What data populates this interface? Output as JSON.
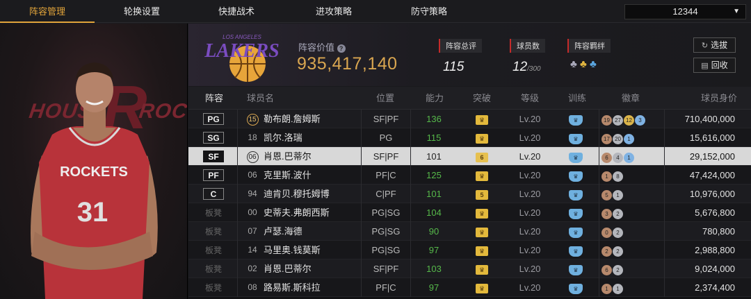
{
  "tabs": [
    {
      "label": "阵容管理",
      "active": true
    },
    {
      "label": "轮换设置",
      "active": false
    },
    {
      "label": "快捷战术",
      "active": false
    },
    {
      "label": "进攻策略",
      "active": false
    },
    {
      "label": "防守策略",
      "active": false
    }
  ],
  "dropdown": {
    "value": "12344"
  },
  "player_panel": {
    "bg_left": "HOUST",
    "bg_right": "ROCK",
    "jersey_team": "ROCKETS",
    "jersey_number": "31"
  },
  "team": {
    "logo_text_top": "LOS ANGELES",
    "logo_text": "LAKERS",
    "value_label": "阵容价值",
    "value": "935,417,140",
    "rating_label": "阵容总评",
    "rating": "115",
    "players_label": "球员数",
    "players": "12",
    "players_max": "/300",
    "bond_label": "阵容羁绊",
    "select_button": "选拔",
    "recycle_button": "回收"
  },
  "table": {
    "headers": [
      "阵容",
      "球员名",
      "位置",
      "能力",
      "突破",
      "等级",
      "训练",
      "徽章",
      "球员身价"
    ],
    "rows": [
      {
        "slot": "PG",
        "starter": true,
        "num": "15",
        "name": "勒布朗.詹姆斯",
        "pos": "SF|PF",
        "ability": "136",
        "breakthrough": "crown",
        "level": "Lv.20",
        "badges": [
          [
            "b",
            "19"
          ],
          [
            "s",
            "27"
          ],
          [
            "g",
            "12"
          ],
          [
            "p",
            "3"
          ]
        ],
        "price": "710,400,000"
      },
      {
        "slot": "SG",
        "starter": true,
        "num": "18",
        "name": "凯尔.洛瑞",
        "pos": "PG",
        "ability": "115",
        "breakthrough": "crown",
        "level": "Lv.20",
        "badges": [
          [
            "b",
            "17"
          ],
          [
            "s",
            "20"
          ],
          [
            "p",
            "1"
          ]
        ],
        "price": "15,616,000"
      },
      {
        "slot": "SF",
        "starter": true,
        "selected": true,
        "num": "06",
        "name": "肖恩.巴蒂尔",
        "pos": "SF|PF",
        "ability": "101",
        "breakthrough": "6",
        "level": "Lv.20",
        "badges": [
          [
            "b",
            "6"
          ],
          [
            "s",
            "4"
          ],
          [
            "p",
            "1"
          ]
        ],
        "price": "29,152,000"
      },
      {
        "slot": "PF",
        "starter": true,
        "num": "06",
        "name": "克里斯.波什",
        "pos": "PF|C",
        "ability": "125",
        "breakthrough": "crown",
        "level": "Lv.20",
        "badges": [
          [
            "b",
            "1"
          ],
          [
            "s",
            "8"
          ]
        ],
        "price": "47,424,000"
      },
      {
        "slot": "C",
        "starter": true,
        "num": "94",
        "name": "迪肯贝.穆托姆博",
        "pos": "C|PF",
        "ability": "101",
        "breakthrough": "5",
        "level": "Lv.20",
        "badges": [
          [
            "b",
            "5"
          ],
          [
            "s",
            "1"
          ]
        ],
        "price": "10,976,000"
      },
      {
        "slot": "板凳",
        "starter": false,
        "num": "00",
        "name": "史蒂夫.弗朗西斯",
        "pos": "PG|SG",
        "ability": "104",
        "breakthrough": "crown",
        "level": "Lv.20",
        "badges": [
          [
            "b",
            "3"
          ],
          [
            "s",
            "2"
          ]
        ],
        "price": "5,676,800"
      },
      {
        "slot": "板凳",
        "starter": false,
        "num": "07",
        "name": "卢瑟.海德",
        "pos": "PG|SG",
        "ability": "90",
        "breakthrough": "crown",
        "level": "Lv.20",
        "badges": [
          [
            "b",
            "0"
          ],
          [
            "s",
            "2"
          ]
        ],
        "price": "780,800"
      },
      {
        "slot": "板凳",
        "starter": false,
        "num": "14",
        "name": "马里奥.钱莫斯",
        "pos": "PG|SG",
        "ability": "97",
        "breakthrough": "crown",
        "level": "Lv.20",
        "badges": [
          [
            "b",
            "2"
          ],
          [
            "s",
            "2"
          ]
        ],
        "price": "2,988,800"
      },
      {
        "slot": "板凳",
        "starter": false,
        "num": "02",
        "name": "肖恩.巴蒂尔",
        "pos": "SF|PF",
        "ability": "103",
        "breakthrough": "crown",
        "level": "Lv.20",
        "badges": [
          [
            "b",
            "6"
          ],
          [
            "s",
            "2"
          ]
        ],
        "price": "9,024,000"
      },
      {
        "slot": "板凳",
        "starter": false,
        "num": "08",
        "name": "路易斯.斯科拉",
        "pos": "PF|C",
        "ability": "97",
        "breakthrough": "crown",
        "level": "Lv.20",
        "badges": [
          [
            "b",
            "1"
          ],
          [
            "s",
            "1"
          ]
        ],
        "price": "2,374,400"
      }
    ]
  },
  "colors": {
    "accent": "#e2a43a",
    "value_gold": "#d9a650",
    "ability_green": "#56b94a",
    "selected_row": "#d8d8d8"
  }
}
